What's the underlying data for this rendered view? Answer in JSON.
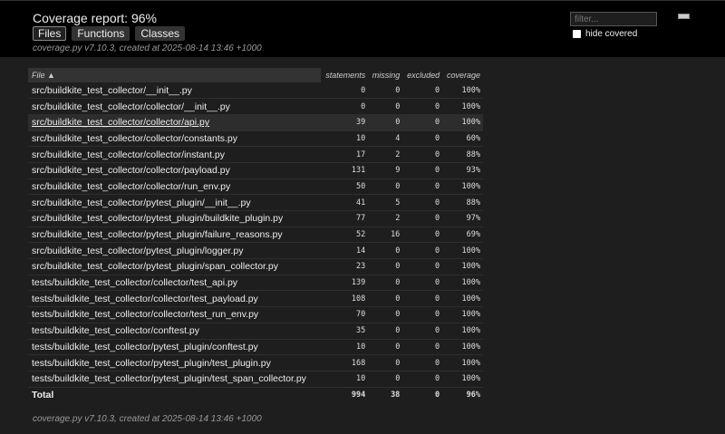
{
  "header": {
    "title": "Coverage report: 96%",
    "tabs": [
      "Files",
      "Functions",
      "Classes"
    ],
    "meta": "coverage.py v7.10.3, created at 2025-08-14 13:46 +1000",
    "filter_placeholder": "filter...",
    "hide_covered": "hide covered"
  },
  "columns": [
    "File ▲",
    "statements",
    "missing",
    "excluded",
    "coverage"
  ],
  "rows": [
    [
      "src/buildkite_test_collector/__init__.py",
      "0",
      "0",
      "0",
      "100%"
    ],
    [
      "src/buildkite_test_collector/collector/__init__.py",
      "0",
      "0",
      "0",
      "100%"
    ],
    [
      "src/buildkite_test_collector/collector/api.py",
      "39",
      "0",
      "0",
      "100%"
    ],
    [
      "src/buildkite_test_collector/collector/constants.py",
      "10",
      "4",
      "0",
      "60%"
    ],
    [
      "src/buildkite_test_collector/collector/instant.py",
      "17",
      "2",
      "0",
      "88%"
    ],
    [
      "src/buildkite_test_collector/collector/payload.py",
      "131",
      "9",
      "0",
      "93%"
    ],
    [
      "src/buildkite_test_collector/collector/run_env.py",
      "50",
      "0",
      "0",
      "100%"
    ],
    [
      "src/buildkite_test_collector/pytest_plugin/__init__.py",
      "41",
      "5",
      "0",
      "88%"
    ],
    [
      "src/buildkite_test_collector/pytest_plugin/buildkite_plugin.py",
      "77",
      "2",
      "0",
      "97%"
    ],
    [
      "src/buildkite_test_collector/pytest_plugin/failure_reasons.py",
      "52",
      "16",
      "0",
      "69%"
    ],
    [
      "src/buildkite_test_collector/pytest_plugin/logger.py",
      "14",
      "0",
      "0",
      "100%"
    ],
    [
      "src/buildkite_test_collector/pytest_plugin/span_collector.py",
      "23",
      "0",
      "0",
      "100%"
    ],
    [
      "tests/buildkite_test_collector/collector/test_api.py",
      "139",
      "0",
      "0",
      "100%"
    ],
    [
      "tests/buildkite_test_collector/collector/test_payload.py",
      "108",
      "0",
      "0",
      "100%"
    ],
    [
      "tests/buildkite_test_collector/collector/test_run_env.py",
      "70",
      "0",
      "0",
      "100%"
    ],
    [
      "tests/buildkite_test_collector/conftest.py",
      "35",
      "0",
      "0",
      "100%"
    ],
    [
      "tests/buildkite_test_collector/pytest_plugin/conftest.py",
      "10",
      "0",
      "0",
      "100%"
    ],
    [
      "tests/buildkite_test_collector/pytest_plugin/test_plugin.py",
      "168",
      "0",
      "0",
      "100%"
    ],
    [
      "tests/buildkite_test_collector/pytest_plugin/test_span_collector.py",
      "10",
      "0",
      "0",
      "100%"
    ]
  ],
  "total": [
    "Total",
    "994",
    "38",
    "0",
    "96%"
  ],
  "footer": "coverage.py v7.10.3, created at 2025-08-14 13:46 +1000"
}
